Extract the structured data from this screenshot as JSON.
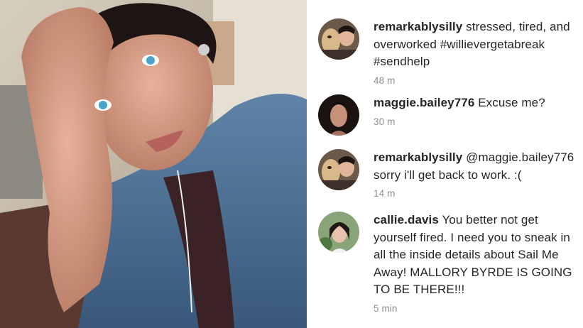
{
  "comments": [
    {
      "username": "remarkablysilly",
      "text": "stressed, tired, and overworked #willievergetabreak #sendhelp",
      "time": "48 m",
      "avatar": "dog-and-man-avatar"
    },
    {
      "username": "maggie.bailey776",
      "text": "Excuse me?",
      "time": "30 m",
      "avatar": "woman-avatar"
    },
    {
      "username": "remarkablysilly",
      "text": "@maggie.bailey776 sorry i'll get back to work. :(",
      "time": "14 m",
      "avatar": "dog-and-man-avatar"
    },
    {
      "username": "callie.davis",
      "text": "You better not get yourself fired. I need you to sneak in all the inside details about Sail Me Away! MALLORY BYRDE IS GOING TO BE THERE!!!",
      "time": "5 min",
      "avatar": "girl-avatar"
    }
  ]
}
